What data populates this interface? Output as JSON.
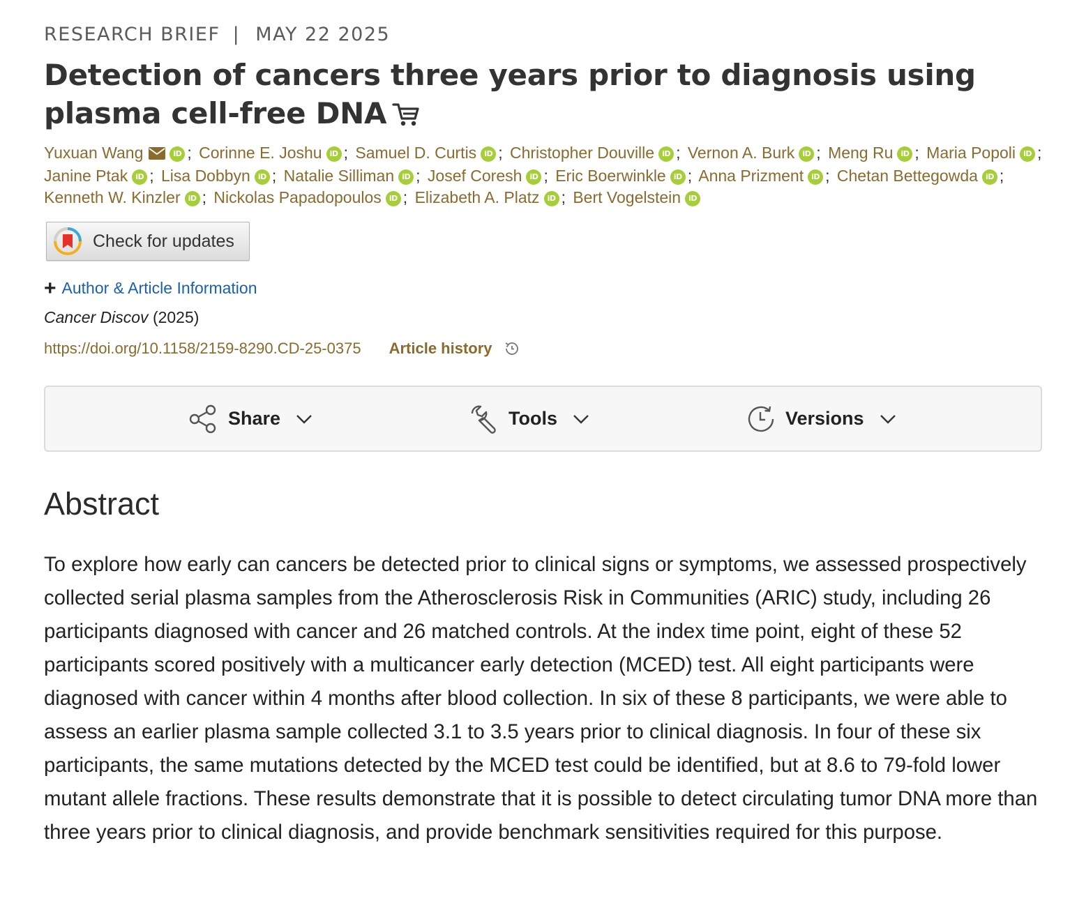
{
  "header": {
    "article_type": "RESEARCH BRIEF",
    "separator": "|",
    "date": "MAY 22 2025"
  },
  "title": "Detection of cancers three years prior to diagnosis using plasma cell-free DNA",
  "authors": [
    {
      "name": "Yuxuan Wang",
      "email": true
    },
    {
      "name": "Corinne E. Joshu"
    },
    {
      "name": "Samuel D. Curtis"
    },
    {
      "name": "Christopher Douville"
    },
    {
      "name": "Vernon A. Burk"
    },
    {
      "name": "Meng Ru"
    },
    {
      "name": "Maria Popoli"
    },
    {
      "name": "Janine Ptak"
    },
    {
      "name": "Lisa Dobbyn"
    },
    {
      "name": "Natalie Silliman"
    },
    {
      "name": "Josef Coresh"
    },
    {
      "name": "Eric Boerwinkle"
    },
    {
      "name": "Anna Prizment"
    },
    {
      "name": "Chetan Bettegowda"
    },
    {
      "name": "Kenneth W. Kinzler"
    },
    {
      "name": "Nickolas Papadopoulos"
    },
    {
      "name": "Elizabeth A. Platz"
    },
    {
      "name": "Bert Vogelstein"
    }
  ],
  "orcid_label": "iD",
  "check_updates": "Check for updates",
  "author_info_link": "Author & Article Information",
  "citation": {
    "journal": "Cancer Discov",
    "year": "(2025)"
  },
  "doi": "https://doi.org/10.1158/2159-8290.CD-25-0375",
  "article_history": "Article history",
  "toolbar": {
    "share": "Share",
    "tools": "Tools",
    "versions": "Versions"
  },
  "abstract": {
    "heading": "Abstract",
    "text": "To explore how early can cancers be detected prior to clinical signs or symptoms, we assessed prospectively collected serial plasma samples from the Atherosclerosis Risk in Communities (ARIC) study, including 26 participants diagnosed with cancer and 26 matched controls. At the index time point, eight of these 52 participants scored positively with a multicancer early detection (MCED) test. All eight participants were diagnosed with cancer within 4 months after blood collection. In six of these 8 participants, we were able to assess an earlier plasma sample collected 3.1 to 3.5 years prior to clinical diagnosis. In four of these six participants, the same mutations detected by the MCED test could be identified, but at 8.6 to 79-fold lower mutant allele fractions. These results demonstrate that it is possible to detect circulating tumor DNA more than three years prior to clinical diagnosis, and provide benchmark sensitivities required for this purpose."
  },
  "colors": {
    "author_link": "#8b6a2e",
    "orcid": "#a6ce39",
    "info_link": "#1a5fb4"
  }
}
